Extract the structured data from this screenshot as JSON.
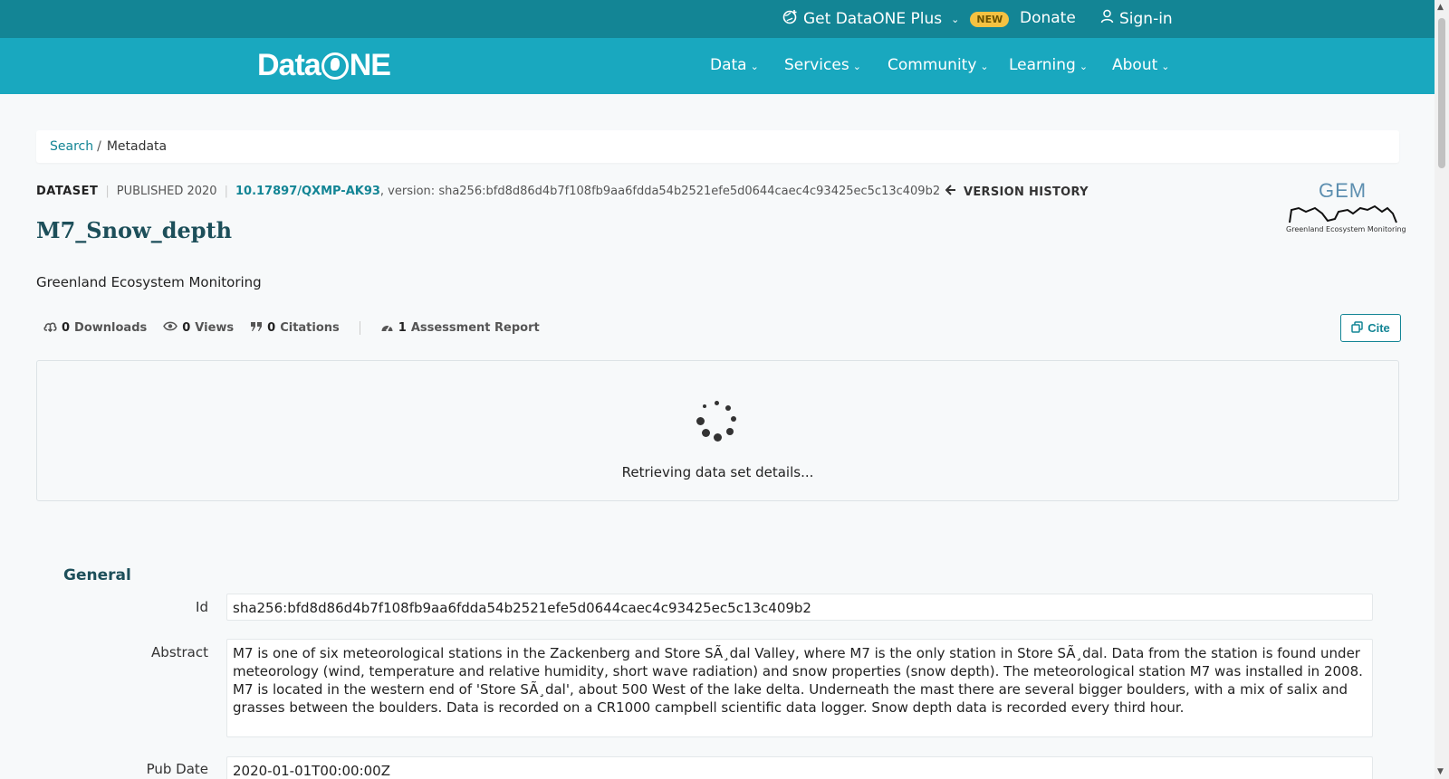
{
  "topbar": {
    "plus_label": "Get DataONE Plus",
    "new_badge": "NEW",
    "donate_label": "Donate",
    "signin_label": "Sign-in"
  },
  "nav": {
    "logo_text_left": "Data",
    "logo_text_right": "NE",
    "items": [
      "Data",
      "Services",
      "Community",
      "Learning",
      "About"
    ]
  },
  "breadcrumb": {
    "search": "Search",
    "separator": "/",
    "current": "Metadata"
  },
  "citation": {
    "type": "DATASET",
    "published": "PUBLISHED 2020",
    "doi": "10.17897/QXMP-AK93",
    "version": ", version: sha256:bfd8d86d4b7f108fb9aa6fdda54b2521efe5d0644caec4c93425ec5c13c409b2",
    "version_history": "VERSION HISTORY"
  },
  "dataset": {
    "title": "M7_Snow_depth",
    "organization": "Greenland Ecosystem Monitoring"
  },
  "gem_logo": {
    "text": "GEM",
    "subtext": "Greenland Ecosystem Monitoring"
  },
  "metrics": {
    "downloads_count": "0",
    "downloads_label": "Downloads",
    "views_count": "0",
    "views_label": "Views",
    "citations_count": "0",
    "citations_label": "Citations",
    "assessment_count": "1",
    "assessment_label": "Assessment Report"
  },
  "cite_button": "Cite",
  "loading": {
    "text": "Retrieving data set details..."
  },
  "general": {
    "title": "General",
    "id_label": "Id",
    "id_value": "sha256:bfd8d86d4b7f108fb9aa6fdda54b2521efe5d0644caec4c93425ec5c13c409b2",
    "abstract_label": "Abstract",
    "abstract_value": "M7 is one of six meteorological stations in the Zackenberg and Store SÃ¸dal Valley, where M7 is the only station in Store SÃ¸dal. Data from the station is found under meteorology (wind, temperature and relative humidity, short wave radiation) and snow properties (snow depth). The meteorological station M7 was installed in 2008. M7 is located in the western end of 'Store SÃ¸dal', about 500 West of the lake delta. Underneath the mast there are several bigger boulders, with a mix of salix and grasses between the boulders. Data is recorded on a CR1000 campbell scientific data logger. Snow depth data is recorded every third hour.",
    "pubdate_label": "Pub Date",
    "pubdate_value": "2020-01-01T00:00:00Z"
  },
  "colors": {
    "topbar": "#138595",
    "navbar": "#19a8bf",
    "accent": "#138595",
    "title": "#1d4f5a",
    "badge": "#f5c242"
  }
}
